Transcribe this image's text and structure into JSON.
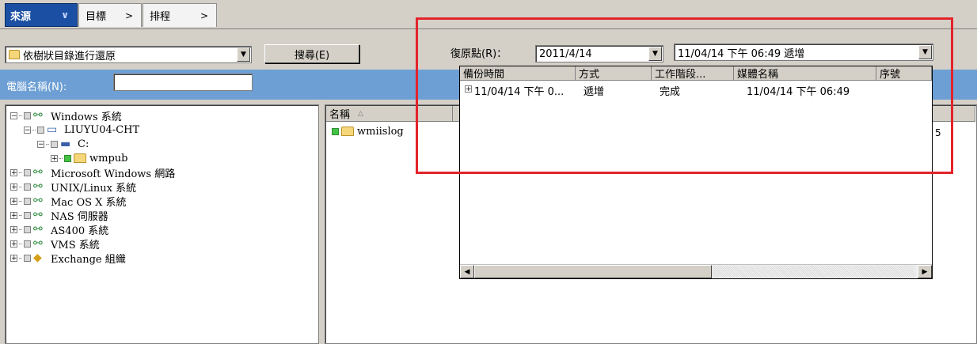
{
  "tabs": [
    {
      "label": "來源",
      "chevron": "∨"
    },
    {
      "label": "目標",
      "chevron": ">"
    },
    {
      "label": "排程",
      "chevron": ">"
    }
  ],
  "restore_mode": {
    "value": "依樹狀目錄進行還原"
  },
  "search_button": {
    "label": "搜尋(E)"
  },
  "computer_name": {
    "label": "電腦名稱(N):",
    "value": ""
  },
  "restore_point": {
    "label": "復原點(R)：",
    "date_value": "2011/4/14",
    "time_value": "11/04/14 下午 06:49   遞增",
    "dropdown": {
      "columns": [
        "備份時間",
        "方式",
        "工作階段...",
        "媒體名稱",
        "序號"
      ],
      "rows": [
        {
          "backup_time": "11/04/14 下午 0...",
          "method": "遞增",
          "job_stage": "完成",
          "media_name": "11/04/14 下午 06:49",
          "serial": ""
        }
      ]
    }
  },
  "tree": [
    {
      "label": "Windows 系統",
      "icon": "network-icon",
      "level": 0,
      "expander": "−"
    },
    {
      "label": "LIUYU04-CHT",
      "icon": "computer-icon",
      "level": 1,
      "expander": "−"
    },
    {
      "label": "C:",
      "icon": "drive-icon",
      "level": 2,
      "expander": "−"
    },
    {
      "label": "wmpub",
      "icon": "folder-icon",
      "level": 3,
      "expander": "+"
    },
    {
      "label": "Microsoft Windows 網路",
      "icon": "network-icon",
      "level": 0,
      "expander": "+"
    },
    {
      "label": "UNIX/Linux 系統",
      "icon": "network-icon",
      "level": 0,
      "expander": "+"
    },
    {
      "label": "Mac OS X 系統",
      "icon": "network-icon",
      "level": 0,
      "expander": "+"
    },
    {
      "label": "NAS 伺服器",
      "icon": "network-icon",
      "level": 0,
      "expander": "+"
    },
    {
      "label": "AS400 系統",
      "icon": "network-icon",
      "level": 0,
      "expander": "+"
    },
    {
      "label": "VMS 系統",
      "icon": "network-icon",
      "level": 0,
      "expander": "+"
    },
    {
      "label": "Exchange 組織",
      "icon": "exchange-icon",
      "level": 0,
      "expander": "+"
    }
  ],
  "file_list": {
    "columns": [
      "名稱"
    ],
    "rows": [
      {
        "name": "wmiislog"
      }
    ],
    "partial_text": "5"
  },
  "colors": {
    "accent": "#1b4fa3",
    "bar": "#6d9fd4",
    "highlight": "#e3232b",
    "check": "#44c245"
  }
}
